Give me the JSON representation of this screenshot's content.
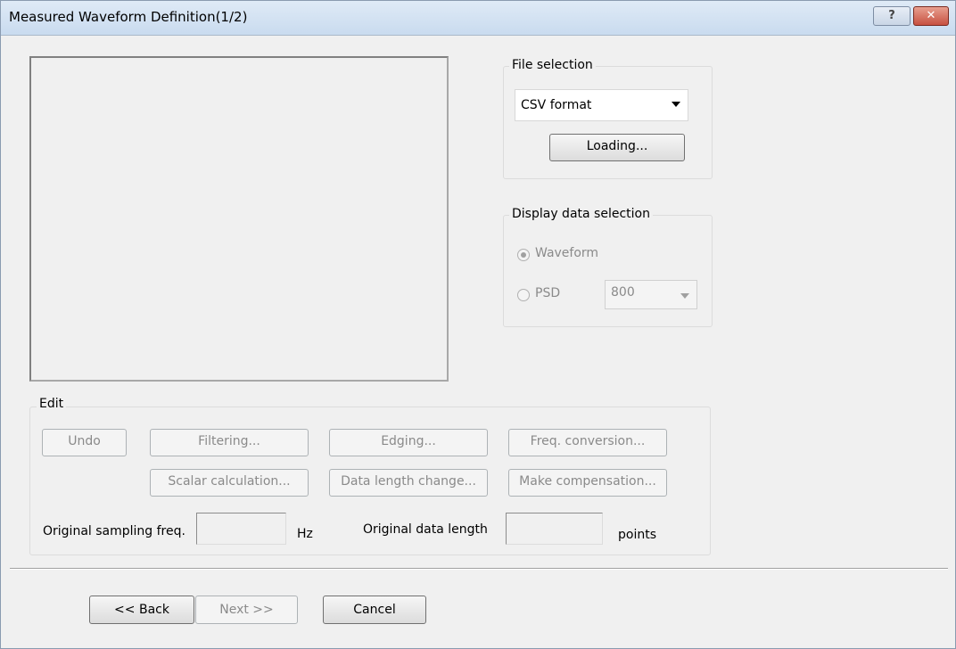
{
  "window": {
    "title": "Measured Waveform Definition(1/2)",
    "help_glyph": "?",
    "close_glyph": "✕"
  },
  "file_selection": {
    "legend": "File selection",
    "format_value": "CSV format",
    "load_label": "Loading..."
  },
  "display_selection": {
    "legend": "Display data selection",
    "waveform_label": "Waveform",
    "waveform_checked": true,
    "psd_label": "PSD",
    "psd_checked": false,
    "psd_value": "800"
  },
  "edit": {
    "legend": "Edit",
    "undo": "Undo",
    "filtering": "Filtering...",
    "edging": "Edging...",
    "freq_conversion": "Freq. conversion...",
    "scalar_calculation": "Scalar calculation...",
    "data_length_change": "Data length change...",
    "make_compensation": "Make compensation...",
    "sampling_label": "Original sampling freq.",
    "sampling_value": "",
    "sampling_unit": "Hz",
    "length_label": "Original data length",
    "length_value": "",
    "length_unit": "points"
  },
  "footer": {
    "back": "<< Back",
    "next": "Next >>",
    "cancel": "Cancel"
  }
}
